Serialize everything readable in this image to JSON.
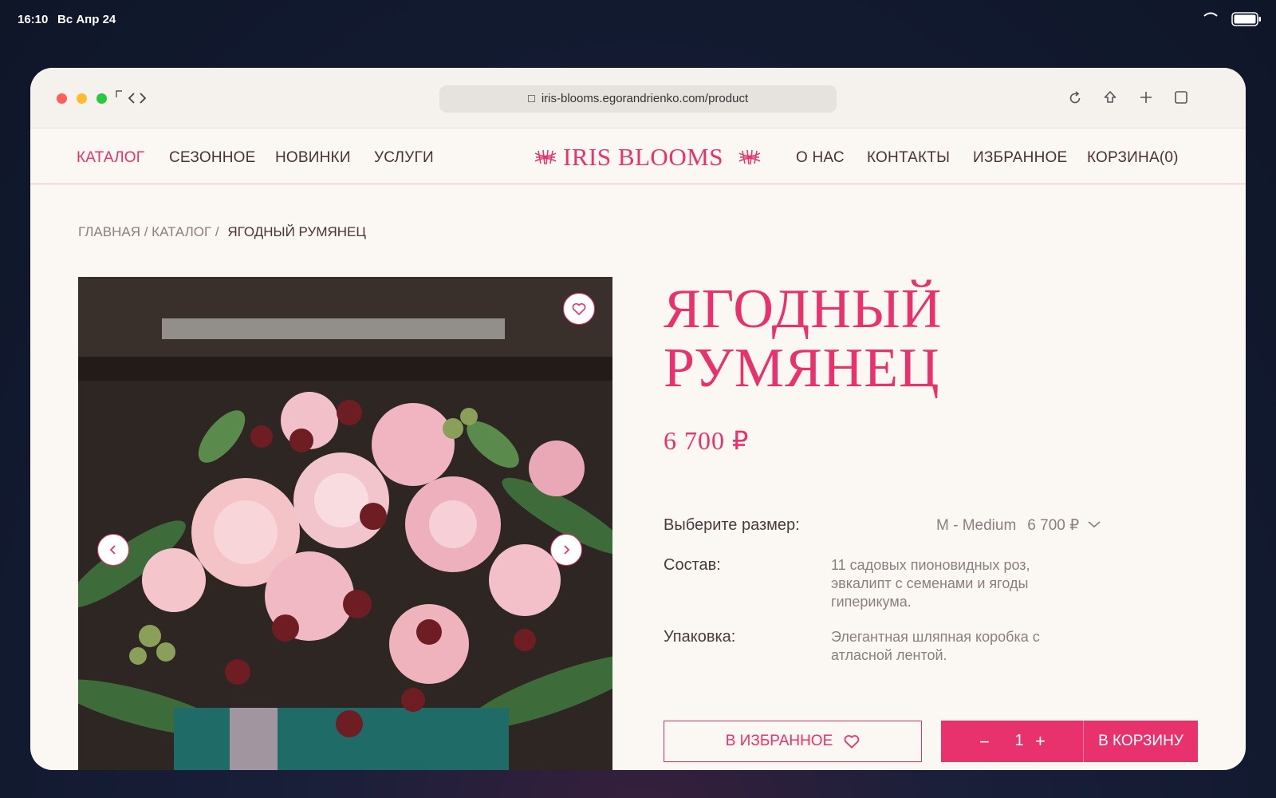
{
  "status_bar": {
    "time": "16:10",
    "date": "Вс Апр 24"
  },
  "browser": {
    "url": "iris-blooms.egorandrienko.com/product"
  },
  "nav": {
    "left": [
      "КАТАЛОГ",
      "СЕЗОННОЕ",
      "НОВИНКИ",
      "УСЛУГИ"
    ],
    "right": [
      "О НАС",
      "КОНТАКТЫ",
      "ИЗБРАННОЕ",
      "КОРЗИНА(0)"
    ],
    "active": "КАТАЛОГ",
    "logo": "IRIS BLOOMS"
  },
  "breadcrumb": {
    "home": "ГЛАВНАЯ /",
    "catalog": "КАТАЛОГ /",
    "current": "ЯГОДНЫЙ РУМЯНЕЦ"
  },
  "product": {
    "title_line1": "ЯГОДНЫЙ",
    "title_line2": "РУМЯНЕЦ",
    "price": "6 700 ₽",
    "size_label": "Выберите размер:",
    "size_value": "M - Medium",
    "size_price": "6 700 ₽",
    "composition_label": "Состав:",
    "composition": "11 садовых пионовидных роз, эвкалипт с семенами и ягоды гиперикума.",
    "packaging_label": "Упаковка:",
    "packaging": "Элегантная шляпная коробка с атласной лентой."
  },
  "actions": {
    "favorite": "В ИЗБРАННОЕ",
    "qty_minus": "−",
    "qty": "1",
    "qty_plus": "+",
    "add_to_cart": "В КОРЗИНУ"
  },
  "colors": {
    "accent": "#e8326e",
    "page_bg": "#fbf8f3",
    "text": "#4a3236",
    "muted": "#8c7e80"
  }
}
